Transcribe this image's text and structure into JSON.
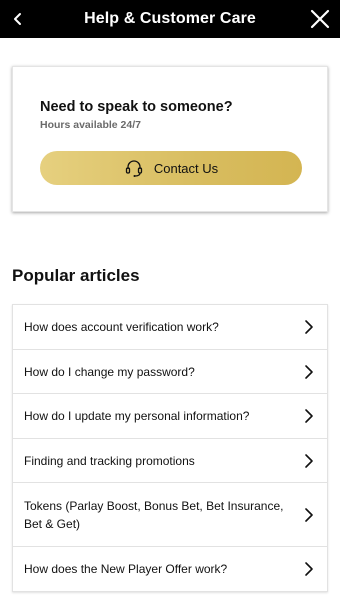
{
  "header": {
    "title": "Help & Customer Care",
    "back_icon": "chevron-left-icon",
    "close_icon": "close-icon"
  },
  "support_card": {
    "title": "Need to speak to someone?",
    "subtitle": "Hours available 24/7",
    "button_label": "Contact Us",
    "button_icon": "headset-icon",
    "button_color": "#d8bd60"
  },
  "popular": {
    "title": "Popular articles",
    "items": [
      {
        "label": "How does account verification work?"
      },
      {
        "label": "How do I change my password?"
      },
      {
        "label": "How do I update my personal information?"
      },
      {
        "label": "Finding and tracking promotions"
      },
      {
        "label": "Tokens (Parlay Boost, Bonus Bet, Bet Insurance, Bet & Get)"
      },
      {
        "label": "How does the New Player Offer work?"
      }
    ]
  }
}
